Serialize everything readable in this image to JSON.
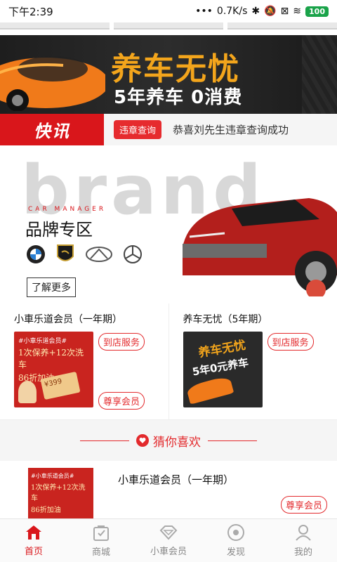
{
  "status": {
    "time": "下午2:39",
    "speed": "0.7K/s",
    "battery": "100"
  },
  "banner": {
    "title": "养车无忧",
    "subtitle": "5年养车 0消费"
  },
  "news": {
    "label": "快讯",
    "tag": "违章查询",
    "text": "恭喜刘先生违章查询成功"
  },
  "brand": {
    "bg_word": "brand",
    "car_manager": "CAR MANAGER",
    "title": "品牌专区",
    "more": "了解更多",
    "logos": [
      "bmw-logo-icon",
      "lamborghini-logo-icon",
      "infiniti-logo-icon",
      "mercedes-logo-icon"
    ]
  },
  "cards": [
    {
      "title": "小車乐道会员（一年期）",
      "top_pill": "到店服务",
      "bottom_pill": "尊享会员",
      "thumb_lines": [
        "#小車乐道会员#",
        "1次保养+12次洗车",
        "86折加油"
      ],
      "price": "¥399"
    },
    {
      "title": "养车无忧（5年期）",
      "top_pill": "到店服务",
      "thumb_lines": [
        "养车无忧",
        "5年0元养车"
      ]
    }
  ],
  "guess": {
    "label": "猜你喜欢",
    "icon": "heart-icon"
  },
  "list_item": {
    "title": "小車乐道会员（一年期）",
    "pill": "尊享会员",
    "thumb_lines": [
      "#小車乐道会员#",
      "1次保养+12次洗车",
      "86折加油"
    ]
  },
  "tabbar": [
    {
      "label": "首页",
      "icon": "home-icon",
      "active": true
    },
    {
      "label": "商城",
      "icon": "shopping-bag-icon",
      "active": false
    },
    {
      "label": "小車会员",
      "icon": "diamond-icon",
      "active": false
    },
    {
      "label": "发现",
      "icon": "compass-icon",
      "active": false
    },
    {
      "label": "我的",
      "icon": "user-icon",
      "active": false
    }
  ],
  "colors": {
    "brand_red": "#d9161b",
    "accent_orange": "#f3a51c"
  }
}
